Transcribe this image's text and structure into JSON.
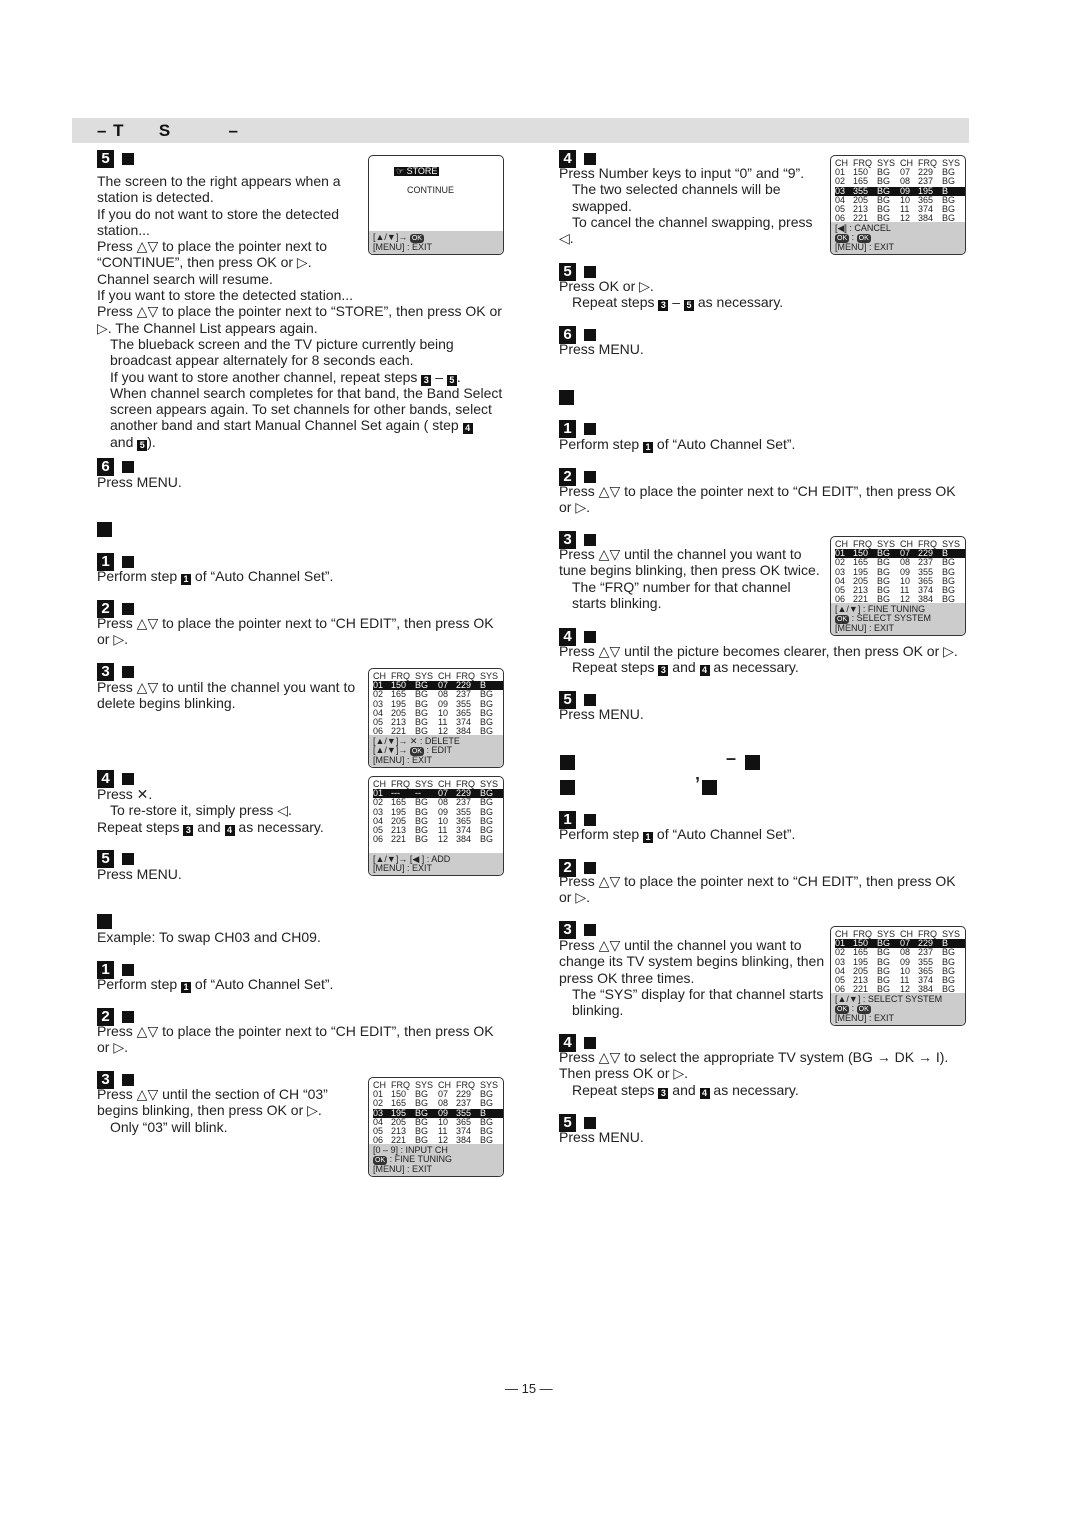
{
  "header": {
    "title": "– T      S          –"
  },
  "left": {
    "s5": {
      "num": "5",
      "lines": [
        "The screen to the right appears when a",
        "station is detected.",
        "If you do not want to store the detected",
        "station...",
        "Press △▽ to place the pointer next to",
        "“CONTINUE”, then press OK or ▷.",
        "Channel search will resume.",
        "If you want to store the detected station...",
        "Press △▽ to place the pointer next to “STORE”, then press OK or",
        "▷. The Channel List appears again.",
        "The blueback screen and the TV picture currently being",
        "broadcast appear alternately for 8 seconds each.",
        "If you want to store another channel, repeat steps {3} – {5}.",
        "When channel search completes for that band, the Band Select",
        "screen appears again. To set channels for other bands, select",
        "another band and start Manual Channel Set again (     step {4}",
        "and {5})."
      ]
    },
    "s6": {
      "num": "6",
      "lines": [
        "Press MENU."
      ]
    },
    "d1": {
      "num": "1",
      "lines": [
        "Perform step {1} of “Auto Channel Set”."
      ]
    },
    "d2": {
      "num": "2",
      "lines": [
        "Press △▽ to place the pointer next to “CH EDIT”, then press OK",
        "or ▷."
      ]
    },
    "d3": {
      "num": "3",
      "lines": [
        "Press △▽ to until the channel you want to",
        "delete begins blinking."
      ]
    },
    "d4": {
      "num": "4",
      "lines": [
        "Press ✕.",
        "To re-store it, simply press ◁.",
        "Repeat steps {3} and {4} as necessary."
      ]
    },
    "d5": {
      "num": "5",
      "lines": [
        "Press MENU."
      ]
    },
    "example": "Example: To swap CH03 and CH09.",
    "w1": {
      "num": "1",
      "lines": [
        "Perform step {1} of “Auto Channel Set”."
      ]
    },
    "w2": {
      "num": "2",
      "lines": [
        "Press △▽ to place the pointer next to “CH EDIT”, then press OK",
        "or ▷."
      ]
    },
    "w3": {
      "num": "3",
      "lines": [
        "Press △▽ until the section of CH “03”",
        "begins blinking, then press OK or ▷.",
        "Only “03” will blink."
      ]
    }
  },
  "right": {
    "w4": {
      "num": "4",
      "lines": [
        "Press Number keys to input “0” and “9”.",
        "The two selected channels will be",
        "swapped.",
        "To cancel the channel swapping, press",
        "◁."
      ]
    },
    "w5": {
      "num": "5",
      "lines": [
        "Press OK or ▷.",
        "Repeat steps {3} – {5} as necessary."
      ]
    },
    "w6": {
      "num": "6",
      "lines": [
        "Press MENU."
      ]
    },
    "f1": {
      "num": "1",
      "lines": [
        "Perform step {1} of “Auto Channel Set”."
      ]
    },
    "f2": {
      "num": "2",
      "lines": [
        "Press △▽ to place the pointer next to “CH EDIT”, then press OK",
        "or ▷."
      ]
    },
    "f3": {
      "num": "3",
      "lines": [
        "Press △▽ until the channel you want to",
        "tune begins blinking, then press OK twice.",
        "The “FRQ” number for that channel",
        "starts blinking."
      ]
    },
    "f4": {
      "num": "4",
      "lines": [
        "Press △▽ until the picture becomes clearer, then press OK or ▷.",
        "Repeat steps {3} and {4} as necessary."
      ]
    },
    "f5": {
      "num": "5",
      "lines": [
        "Press MENU."
      ]
    },
    "heading_marks": [
      "–",
      "’"
    ],
    "t1": {
      "num": "1",
      "lines": [
        "Perform step {1} of “Auto Channel Set”."
      ]
    },
    "t2": {
      "num": "2",
      "lines": [
        "Press △▽ to place the pointer next to “CH EDIT”, then press OK",
        "or ▷."
      ]
    },
    "t3": {
      "num": "3",
      "lines": [
        "Press △▽ until the channel you want to",
        "change its TV system begins blinking, then",
        "press OK three times.",
        "The “SYS” display for that channel starts",
        "blinking."
      ]
    },
    "t4": {
      "num": "4",
      "lines": [
        "Press △▽ to select the appropriate TV system (BG → DK → I).",
        "Then press OK or ▷.",
        "Repeat steps {3} and {4} as necessary."
      ]
    },
    "t5": {
      "num": "5",
      "lines": [
        "Press MENU."
      ]
    }
  },
  "screens": [
    {
      "id": "store",
      "items": [
        "STORE",
        "CONTINUE"
      ],
      "footer": [
        "[▲/▼]→ OK",
        "[MENU] : EXIT"
      ]
    },
    {
      "id": "delete",
      "cols": [
        "CH",
        "FRQ",
        "SYS",
        "CH",
        "FRQ",
        "SYS"
      ],
      "rows": [
        [
          "01",
          "150",
          "BG",
          "07",
          "229",
          "B"
        ],
        [
          "02",
          "165",
          "BG",
          "08",
          "237",
          "BG"
        ],
        [
          "03",
          "195",
          "BG",
          "09",
          "355",
          "BG"
        ],
        [
          "04",
          "205",
          "BG",
          "10",
          "365",
          "BG"
        ],
        [
          "05",
          "213",
          "BG",
          "11",
          "374",
          "BG"
        ],
        [
          "06",
          "221",
          "BG",
          "12",
          "384",
          "BG"
        ]
      ],
      "highlight": 0,
      "footer": [
        "[▲/▼]→ ✕ : DELETE",
        "[▲/▼]→ OK : EDIT",
        "[MENU] : EXIT"
      ]
    },
    {
      "id": "deleted",
      "cols": [
        "CH",
        "FRQ",
        "SYS",
        "CH",
        "FRQ",
        "SYS"
      ],
      "rows": [
        [
          "01",
          "---",
          "--",
          "07",
          "229",
          "BG"
        ],
        [
          "02",
          "165",
          "BG",
          "08",
          "237",
          "BG"
        ],
        [
          "03",
          "195",
          "BG",
          "09",
          "355",
          "BG"
        ],
        [
          "04",
          "205",
          "BG",
          "10",
          "365",
          "BG"
        ],
        [
          "05",
          "213",
          "BG",
          "11",
          "374",
          "BG"
        ],
        [
          "06",
          "221",
          "BG",
          "12",
          "384",
          "BG"
        ]
      ],
      "highlight": 0,
      "footer": [
        "[▲/▼]→ [◀ ] : ADD",
        "[MENU] : EXIT"
      ]
    },
    {
      "id": "swap-select",
      "cols": [
        "CH",
        "FRQ",
        "SYS",
        "CH",
        "FRQ",
        "SYS"
      ],
      "rows": [
        [
          "01",
          "150",
          "BG",
          "07",
          "229",
          "BG"
        ],
        [
          "02",
          "165",
          "BG",
          "08",
          "237",
          "BG"
        ],
        [
          "03",
          "195",
          "BG",
          "09",
          "355",
          "B"
        ],
        [
          "04",
          "205",
          "BG",
          "10",
          "365",
          "BG"
        ],
        [
          "05",
          "213",
          "BG",
          "11",
          "374",
          "BG"
        ],
        [
          "06",
          "221",
          "BG",
          "12",
          "384",
          "BG"
        ]
      ],
      "highlight": 2,
      "footer": [
        "[0 – 9] : INPUT CH",
        "OK : FINE TUNING",
        "[MENU] : EXIT"
      ]
    },
    {
      "id": "swap-done",
      "cols": [
        "CH",
        "FRQ",
        "SYS",
        "CH",
        "FRQ",
        "SYS"
      ],
      "rows": [
        [
          "01",
          "150",
          "BG",
          "07",
          "229",
          "BG"
        ],
        [
          "02",
          "165",
          "BG",
          "08",
          "237",
          "BG"
        ],
        [
          "03",
          "355",
          "BG",
          "09",
          "195",
          "B"
        ],
        [
          "04",
          "205",
          "BG",
          "10",
          "365",
          "BG"
        ],
        [
          "05",
          "213",
          "BG",
          "11",
          "374",
          "BG"
        ],
        [
          "06",
          "221",
          "BG",
          "12",
          "384",
          "BG"
        ]
      ],
      "highlight": 2,
      "footer": [
        "[◀] : CANCEL",
        "OK : OK",
        "[MENU] : EXIT"
      ]
    },
    {
      "id": "fine-tuning",
      "cols": [
        "CH",
        "FRQ",
        "SYS",
        "CH",
        "FRQ",
        "SYS"
      ],
      "rows": [
        [
          "01",
          "150",
          "BG",
          "07",
          "229",
          "B"
        ],
        [
          "02",
          "165",
          "BG",
          "08",
          "237",
          "BG"
        ],
        [
          "03",
          "195",
          "BG",
          "09",
          "355",
          "BG"
        ],
        [
          "04",
          "205",
          "BG",
          "10",
          "365",
          "BG"
        ],
        [
          "05",
          "213",
          "BG",
          "11",
          "374",
          "BG"
        ],
        [
          "06",
          "221",
          "BG",
          "12",
          "384",
          "BG"
        ]
      ],
      "highlight": 0,
      "footer": [
        "[▲/▼] : FINE TUNING",
        "OK : SELECT SYSTEM",
        "[MENU] : EXIT"
      ]
    },
    {
      "id": "system",
      "cols": [
        "CH",
        "FRQ",
        "SYS",
        "CH",
        "FRQ",
        "SYS"
      ],
      "rows": [
        [
          "01",
          "150",
          "BG",
          "07",
          "229",
          "B"
        ],
        [
          "02",
          "165",
          "BG",
          "08",
          "237",
          "BG"
        ],
        [
          "03",
          "195",
          "BG",
          "09",
          "355",
          "BG"
        ],
        [
          "04",
          "205",
          "BG",
          "10",
          "365",
          "BG"
        ],
        [
          "05",
          "213",
          "BG",
          "11",
          "374",
          "BG"
        ],
        [
          "06",
          "221",
          "BG",
          "12",
          "384",
          "BG"
        ]
      ],
      "highlight": 0,
      "footer": [
        "[▲/▼] : SELECT SYSTEM",
        "OK : OK",
        "[MENU] : EXIT"
      ]
    }
  ],
  "page_number": "— 15 —"
}
